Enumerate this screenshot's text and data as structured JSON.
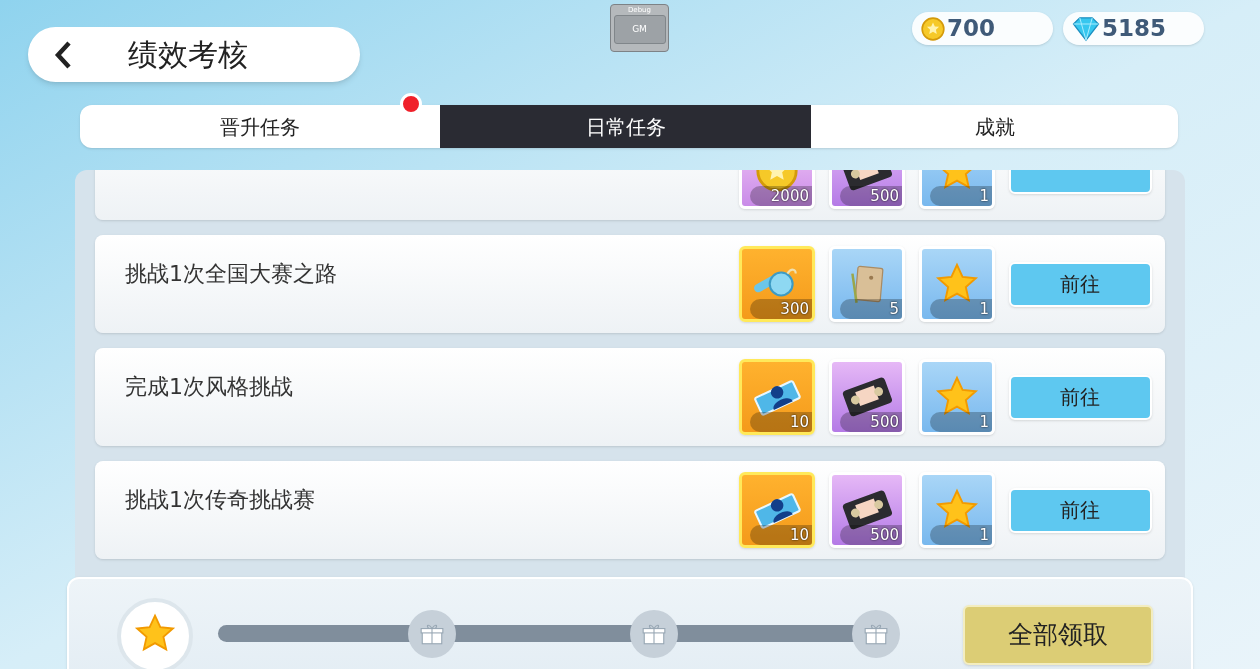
{
  "header": {
    "title": "绩效考核"
  },
  "debug": {
    "label": "Debug",
    "button": "GM"
  },
  "currencies": [
    {
      "kind": "coin",
      "amount": "700"
    },
    {
      "kind": "diamond",
      "amount": "5185"
    }
  ],
  "tabs": [
    {
      "label": "晋升任务",
      "selected": false,
      "badge": true
    },
    {
      "label": "日常任务",
      "selected": true,
      "badge": false
    },
    {
      "label": "成就",
      "selected": false,
      "badge": false
    }
  ],
  "tasks": [
    {
      "rewards": [
        {
          "kind": "coin",
          "count": "2000"
        },
        {
          "kind": "tape",
          "count": "500"
        },
        {
          "kind": "star",
          "count": "1"
        }
      ]
    },
    {
      "title": "挑战1次全国大赛之路",
      "button": "前往",
      "rewards": [
        {
          "kind": "whistle",
          "count": "300"
        },
        {
          "kind": "envelope",
          "count": "5"
        },
        {
          "kind": "star",
          "count": "1"
        }
      ]
    },
    {
      "title": "完成1次风格挑战",
      "button": "前往",
      "rewards": [
        {
          "kind": "ticket",
          "count": "10"
        },
        {
          "kind": "tape",
          "count": "500"
        },
        {
          "kind": "star",
          "count": "1"
        }
      ]
    },
    {
      "title": "挑战1次传奇挑战赛",
      "button": "前往",
      "rewards": [
        {
          "kind": "ticket",
          "count": "10"
        },
        {
          "kind": "tape",
          "count": "500"
        },
        {
          "kind": "star",
          "count": "1"
        }
      ]
    }
  ],
  "progress": {
    "milestones": [
      {
        "kind": "gift"
      },
      {
        "kind": "gift"
      },
      {
        "kind": "gift"
      }
    ],
    "claim_all": "全部领取"
  }
}
